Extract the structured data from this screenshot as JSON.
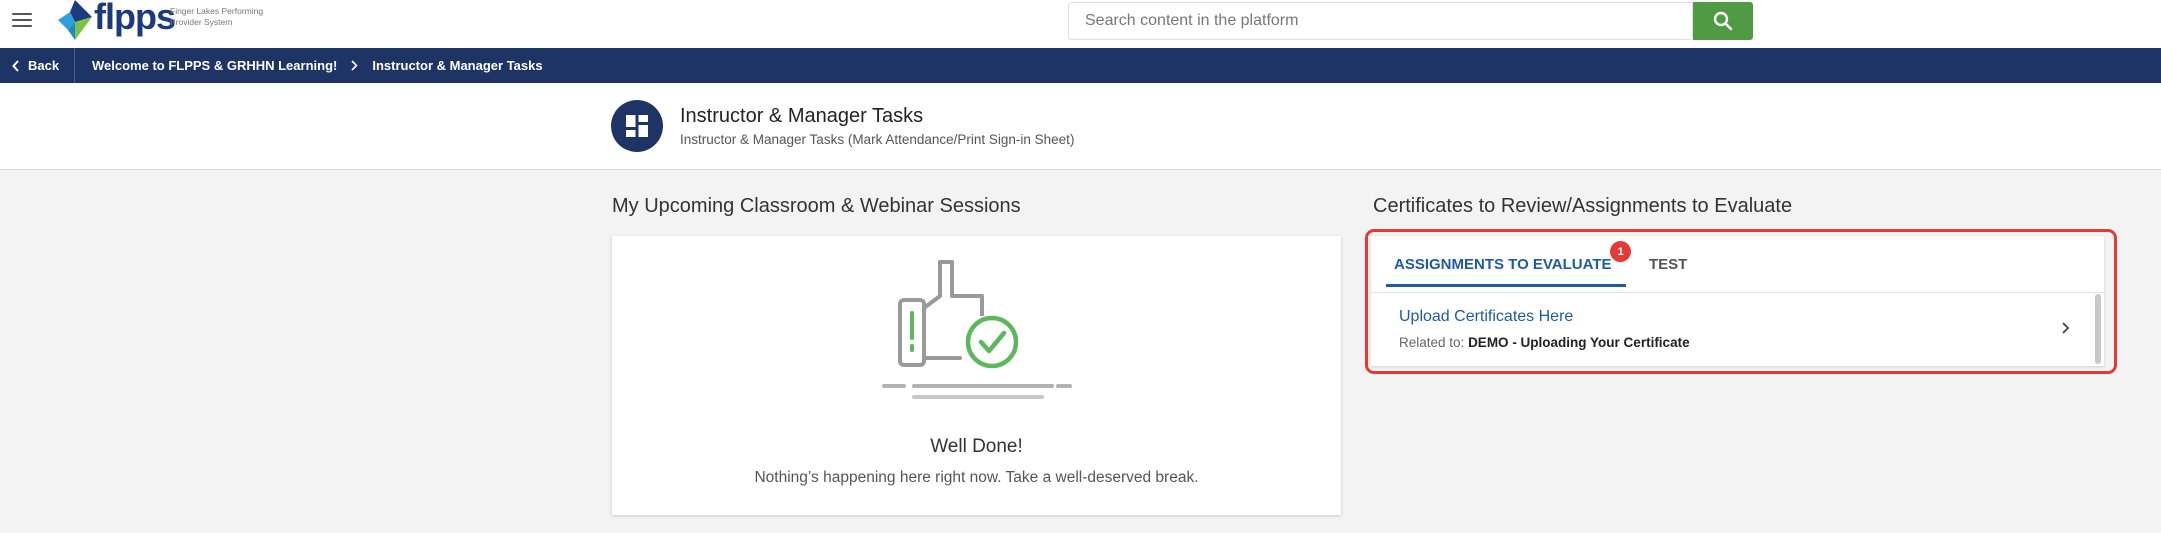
{
  "header": {
    "logo_word": "flpps",
    "logo_tagline": "Finger Lakes Performing Provider System",
    "search_placeholder": "Search content in the platform"
  },
  "nav": {
    "back_label": "Back",
    "breadcrumb": [
      "Welcome to FLPPS & GRHHN Learning!",
      "Instructor & Manager Tasks"
    ]
  },
  "page": {
    "title": "Instructor & Manager Tasks",
    "subtitle": "Instructor & Manager Tasks (Mark Attendance/Print Sign-in Sheet)"
  },
  "sessions": {
    "title": "My Upcoming Classroom & Webinar Sessions",
    "empty_title": "Well Done!",
    "empty_message": "Nothing’s happening here right now. Take a well-deserved break."
  },
  "review": {
    "title": "Certificates to Review/Assignments to Evaluate",
    "tabs": [
      {
        "label": "ASSIGNMENTS TO EVALUATE",
        "badge": "1",
        "active": true
      },
      {
        "label": "TEST",
        "active": false
      }
    ],
    "items": [
      {
        "title": "Upload Certificates Here",
        "related_prefix": "Related to:",
        "related_value": "DEMO - Uploading Your Certificate"
      }
    ]
  },
  "colors": {
    "navy": "#1e3465",
    "accent_blue": "#1f5aa6",
    "search_green": "#4f9a42",
    "highlight_red": "#e53935",
    "check_green": "#5cb85c"
  },
  "icons": [
    "menu-icon",
    "flpps-logo-mark",
    "search-icon",
    "chevron-left-icon",
    "chevron-right-icon",
    "dashboard-icon",
    "thumbs-up-check-illustration"
  ]
}
